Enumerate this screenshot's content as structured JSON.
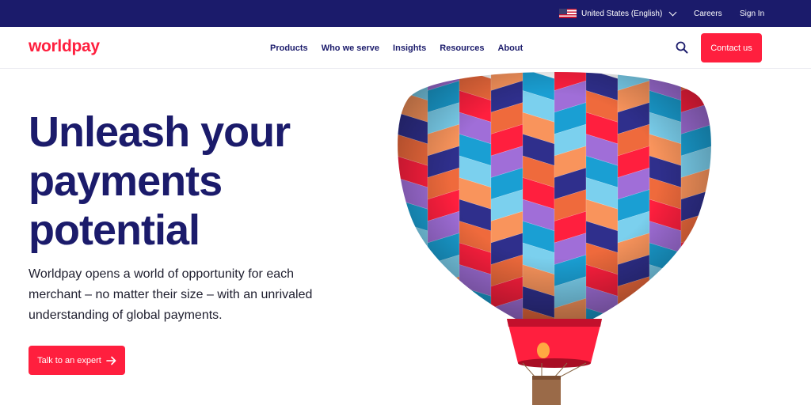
{
  "topbar": {
    "locale": "United States (English)",
    "links": {
      "careers": "Careers",
      "sign_in": "Sign In"
    }
  },
  "header": {
    "logo": "worldpay",
    "nav": [
      "Products",
      "Who we serve",
      "Insights",
      "Resources",
      "About"
    ],
    "contact_label": "Contact us"
  },
  "hero": {
    "title_lines": [
      "Unleash your",
      "payments",
      "potential"
    ],
    "description": "Worldpay opens a world of opportunity for each merchant – no matter their size – with an unrivaled understanding of global payments.",
    "cta_label": "Talk to an expert",
    "cta_icon": "arrow-right-icon",
    "image": "hot-air-balloon"
  },
  "icons": {
    "search": "search-icon",
    "locale_dropdown": "chevron-down-icon",
    "flag": "us-flag-icon"
  },
  "colors": {
    "navy": "#1b1b6b",
    "brand_red": "#ff1f3e",
    "balloon": [
      "#7bd0ee",
      "#ff1f3e",
      "#f9945c",
      "#a06ed8",
      "#2f2f8c",
      "#1a9fd3",
      "#ef6a3c"
    ]
  }
}
